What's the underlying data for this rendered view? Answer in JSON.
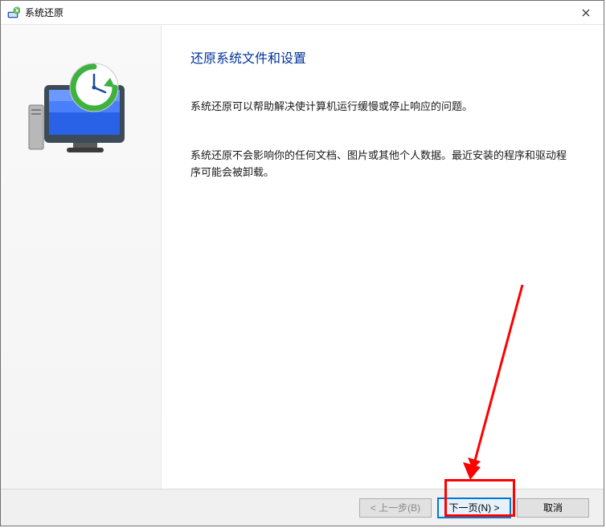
{
  "titlebar": {
    "title": "系统还原"
  },
  "content": {
    "heading": "还原系统文件和设置",
    "paragraph1": "系统还原可以帮助解决使计算机运行缓慢或停止响应的问题。",
    "paragraph2": "系统还原不会影响你的任何文档、图片或其他个人数据。最近安装的程序和驱动程序可能会被卸载。"
  },
  "footer": {
    "back_label": "< 上一步(B)",
    "next_label": "下一页(N) >",
    "cancel_label": "取消"
  }
}
